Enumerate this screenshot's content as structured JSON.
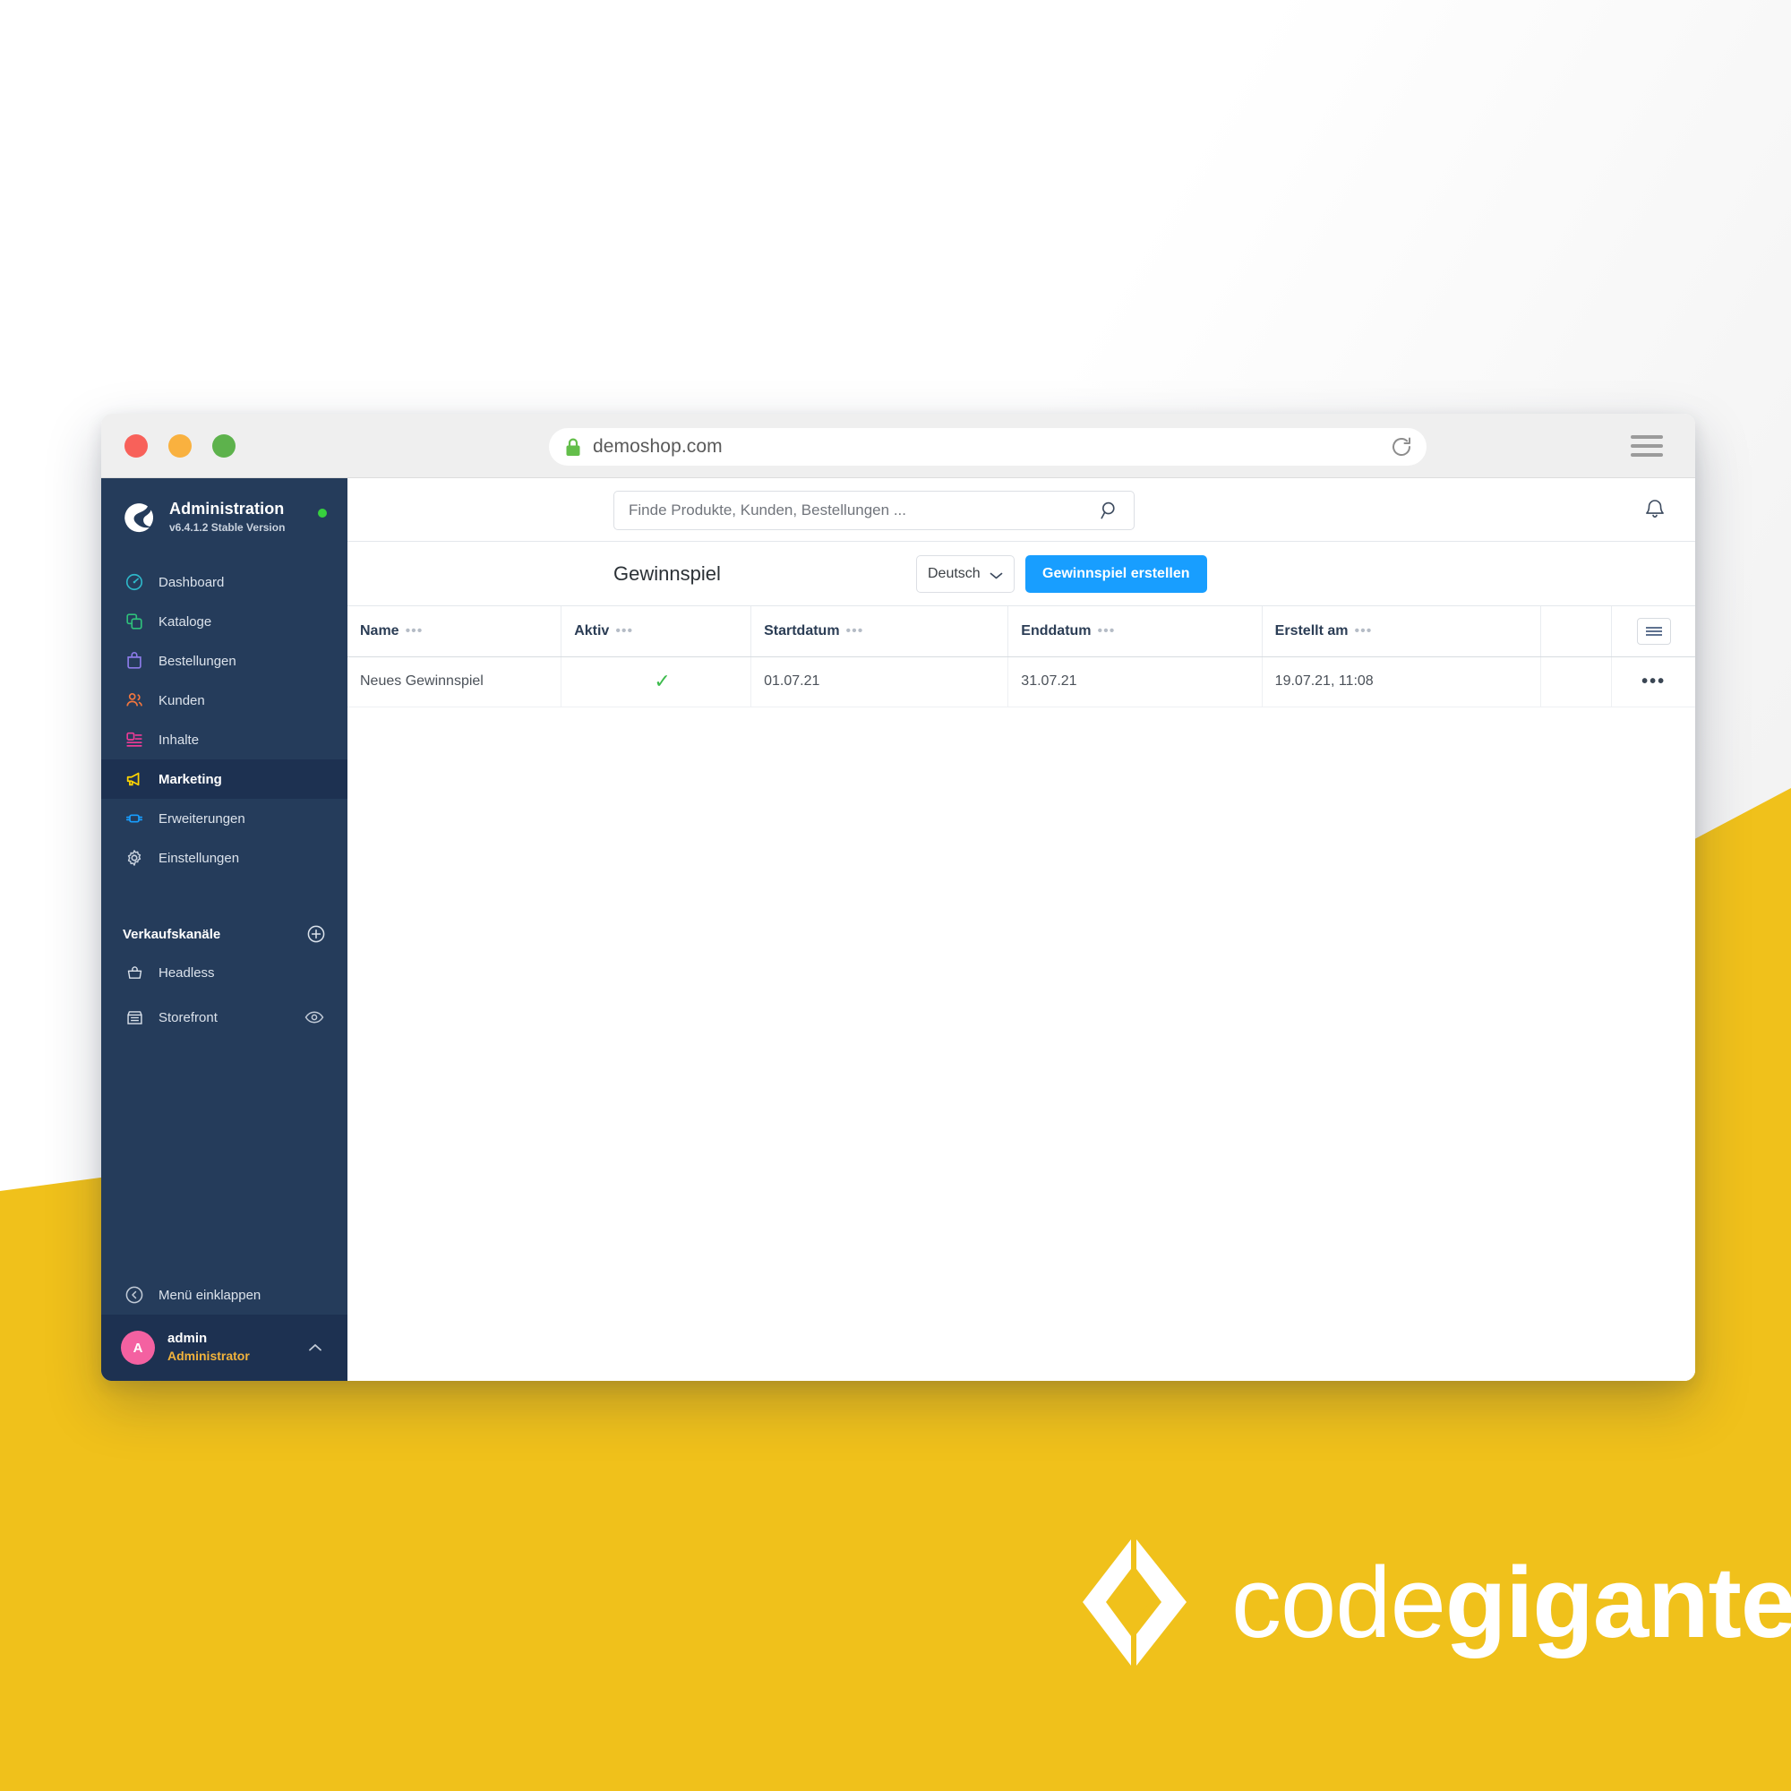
{
  "browser": {
    "url": "demoshop.com",
    "lock_icon": "lock-icon",
    "reload_icon": "reload-icon",
    "menu_icon": "hamburger-menu-icon",
    "traffic_lights": [
      "close",
      "minimize",
      "maximize"
    ]
  },
  "sidebar": {
    "brand": {
      "title": "Administration",
      "version": "v6.4.1.2 Stable Version",
      "logo_icon": "shopware-logo-icon",
      "status_color": "#37D03E"
    },
    "items": [
      {
        "label": "Dashboard",
        "icon": "dashboard-gauge-icon",
        "color": "#2EB6C8",
        "active": false
      },
      {
        "label": "Kataloge",
        "icon": "catalog-copy-icon",
        "color": "#2FC07B",
        "active": false
      },
      {
        "label": "Bestellungen",
        "icon": "orders-bag-icon",
        "color": "#8C7BE8",
        "active": false
      },
      {
        "label": "Kunden",
        "icon": "customers-people-icon",
        "color": "#F2763E",
        "active": false
      },
      {
        "label": "Inhalte",
        "icon": "content-layout-icon",
        "color": "#ED3B96",
        "active": false
      },
      {
        "label": "Marketing",
        "icon": "marketing-megaphone-icon",
        "color": "#FFD500",
        "active": true
      },
      {
        "label": "Erweiterungen",
        "icon": "extensions-plug-icon",
        "color": "#189EFF",
        "active": false
      },
      {
        "label": "Einstellungen",
        "icon": "settings-gear-icon",
        "color": "#C9D2DE",
        "active": false
      }
    ],
    "sales_channels": {
      "title": "Verkaufskanäle",
      "add_icon": "plus-circle-icon",
      "channels": [
        {
          "label": "Headless",
          "icon": "headless-basket-icon",
          "has_eye": false
        },
        {
          "label": "Storefront",
          "icon": "storefront-shop-icon",
          "has_eye": true,
          "eye_icon": "eye-icon"
        }
      ]
    },
    "collapse": {
      "label": "Menü einklappen",
      "icon": "chevron-left-circle-icon"
    },
    "user": {
      "initial": "A",
      "name": "admin",
      "role": "Administrator",
      "chevron_icon": "chevron-up-icon",
      "avatar_color": "#F461A1"
    }
  },
  "topbar": {
    "search_placeholder": "Finde Produkte, Kunden, Bestellungen ...",
    "search_value": "",
    "search_icon": "search-icon",
    "notification_icon": "bell-icon"
  },
  "page": {
    "title": "Gewinnspiel",
    "language_selected": "Deutsch",
    "language_chevron": "chevron-down-icon",
    "create_button": "Gewinnspiel erstellen",
    "create_button_color": "#189EFF"
  },
  "table": {
    "columns": [
      {
        "label": "Name",
        "menu": "•••"
      },
      {
        "label": "Aktiv",
        "menu": "•••"
      },
      {
        "label": "Startdatum",
        "menu": "•••"
      },
      {
        "label": "Enddatum",
        "menu": "•••"
      },
      {
        "label": "Erstellt am",
        "menu": "•••"
      },
      {
        "label": "",
        "menu": ""
      },
      {
        "label": "",
        "menu": ""
      }
    ],
    "column_config_icon": "column-settings-icon",
    "rows": [
      {
        "name": "Neues Gewinnspiel",
        "aktiv": "✓",
        "aktiv_color": "#3DBB4D",
        "startdatum": "01.07.21",
        "enddatum": "31.07.21",
        "erstellt_am": "19.07.21, 11:08",
        "blank": "",
        "row_menu": "•••"
      }
    ]
  },
  "footer": {
    "brand_word_light": "code",
    "brand_word_bold": "giganten",
    "brand_mark_icon": "codegiganten-diamond-icon",
    "background_color": "#F0C11B"
  }
}
